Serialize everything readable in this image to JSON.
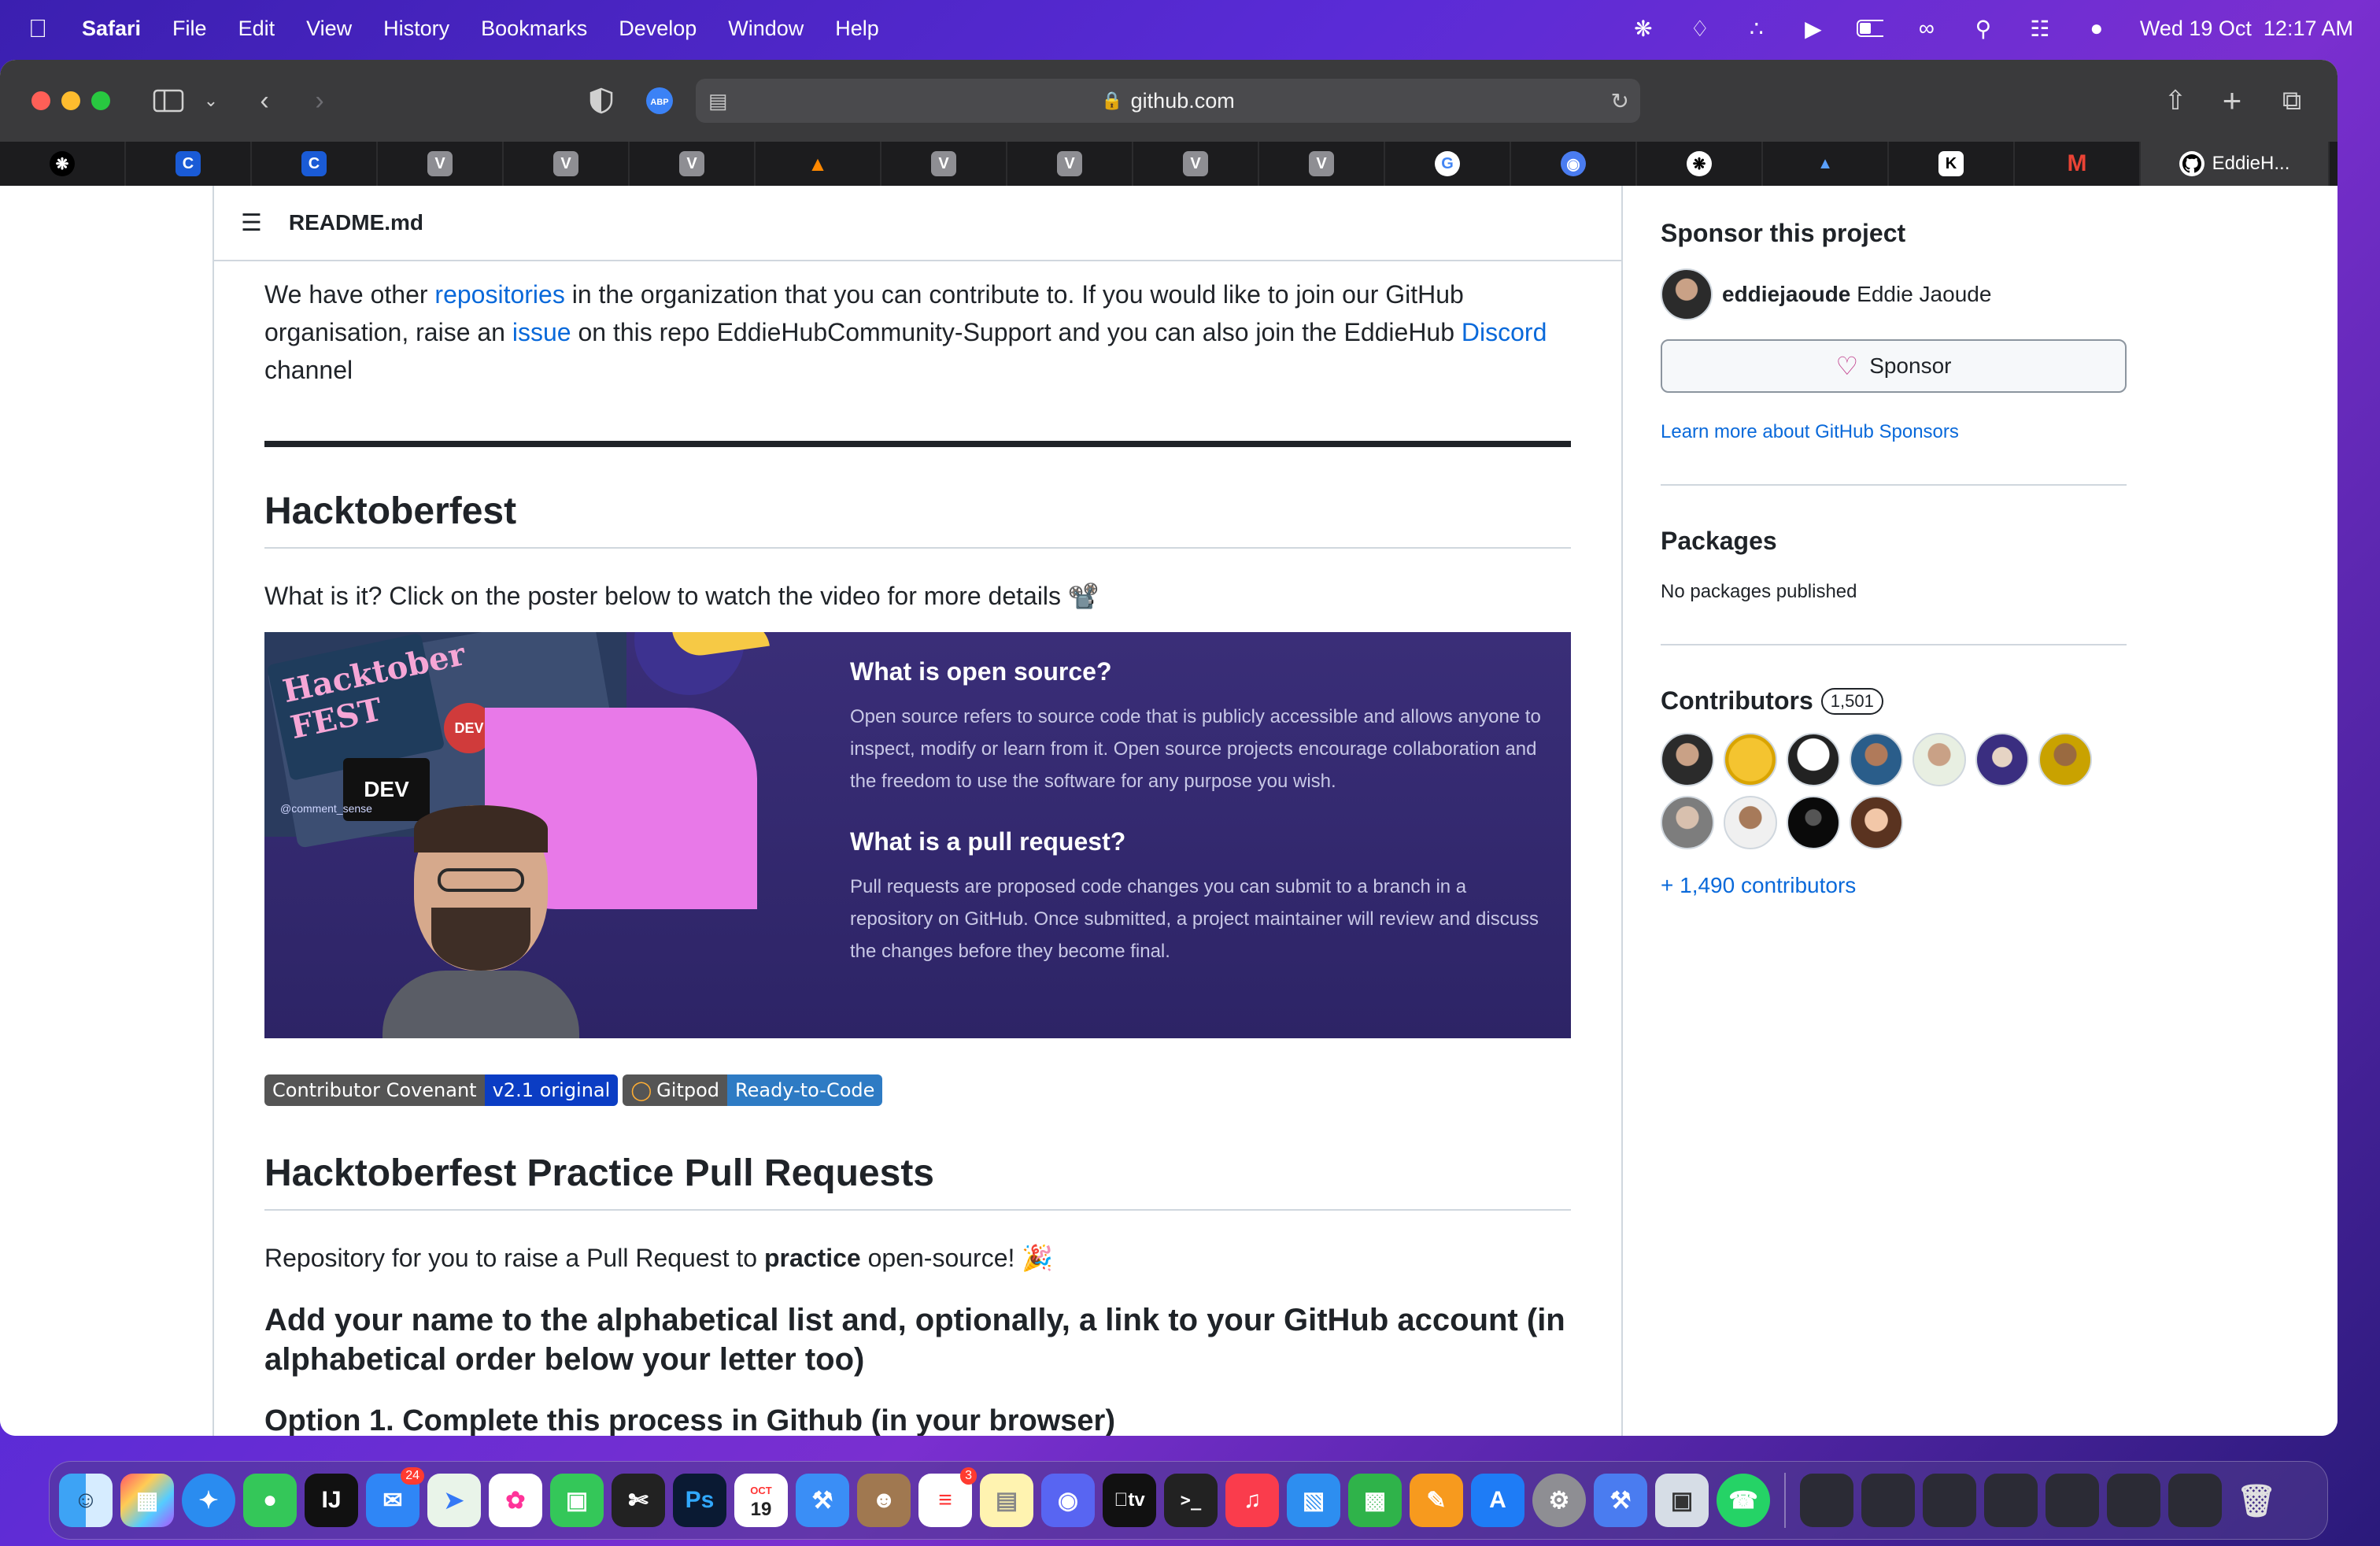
{
  "menubar": {
    "app": "Safari",
    "items": [
      "File",
      "Edit",
      "View",
      "History",
      "Bookmarks",
      "Develop",
      "Window",
      "Help"
    ],
    "datetime": "Wed 19 Oct  12:17 AM"
  },
  "browser": {
    "url": "github.com",
    "active_tab": "EddieH...",
    "tab_favicons": [
      "V",
      "V",
      "V",
      "V",
      "V",
      "V",
      "V"
    ]
  },
  "readme": {
    "filename": "README.md",
    "intro_pre": "We have other ",
    "intro_link1": "repositories",
    "intro_mid1": " in the organization that you can contribute to. If you would like to join our GitHub organisation, raise an ",
    "intro_link2": "issue",
    "intro_mid2": " on this repo EddieHubCommunity-Support and you can also join the EddieHub ",
    "intro_link3": "Discord",
    "intro_end": " channel",
    "h_hacktoberfest": "Hacktoberfest",
    "what_is_it": "What is it? Click on the poster below to watch the video for more details 📽️",
    "poster": {
      "q1": "What is open source?",
      "a1": "Open source refers to source code that is publicly accessible and allows anyone to inspect, modify or learn from it. Open source projects encourage collaboration and the freedom to use the software for any purpose you wish.",
      "q2": "What is a pull request?",
      "a2": "Pull requests are proposed code changes you can submit to a branch in a repository on GitHub. Once submitted, a project maintainer will review and discuss the changes before they become final.",
      "sticker1": "DEV",
      "sticker2": "@comment_sense"
    },
    "badges": [
      {
        "left": "Contributor Covenant",
        "right": "v2.1 original"
      },
      {
        "left": "Gitpod",
        "right": "Ready-to-Code"
      }
    ],
    "h_practice": "Hacktoberfest Practice Pull Requests",
    "practice_pre": "Repository for you to raise a Pull Request to ",
    "practice_bold": "practice",
    "practice_post": " open-source! 🎉",
    "h_add_name": "Add your name to the alphabetical list and, optionally, a link to your GitHub account (in alphabetical order below your letter too)",
    "h_option1": "Option 1. Complete this process in Github (in your browser)"
  },
  "sidebar": {
    "sponsor_title": "Sponsor this project",
    "sponsor_user": "eddiejaoude",
    "sponsor_name": "Eddie Jaoude",
    "sponsor_button": "Sponsor",
    "sponsor_learn": "Learn more about GitHub Sponsors",
    "packages_title": "Packages",
    "packages_text": "No packages published",
    "contributors_title": "Contributors",
    "contributors_count": "1,501",
    "contributors_more": "+ 1,490 contributors"
  },
  "dock": {
    "mail_badge": "24",
    "calendar_month": "OCT",
    "calendar_day": "19",
    "reminders_badge": "3",
    "ps_label": "Ps",
    "ij_label": "IJ",
    "tv_label": "tv"
  },
  "colors": {
    "link": "#0969da",
    "badge_blue": "#0b3dc4",
    "gitpod_blue": "#2e7bc4",
    "poster_bg": "#2f2566",
    "poster_pink": "#e879e8"
  }
}
